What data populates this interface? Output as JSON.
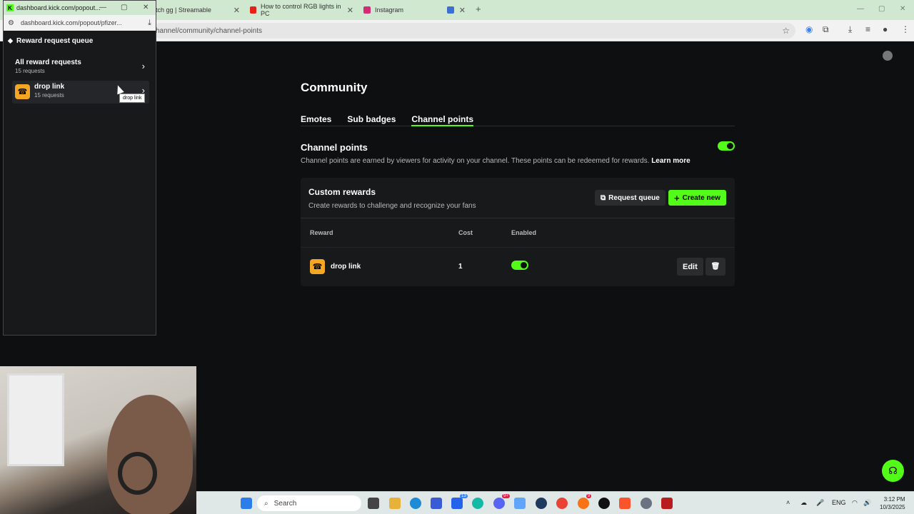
{
  "browser": {
    "tabs": [
      {
        "label": "tch gg | Streamable"
      },
      {
        "label": "How to control RGB lights in PC"
      },
      {
        "label": "Instagram"
      },
      {
        "label": ""
      }
    ],
    "new_tab": "+",
    "url": "hannel/community/channel-points"
  },
  "popout": {
    "title": "dashboard.kick.com/popout...",
    "url": "dashboard.kick.com/popout/pfizer...",
    "heading": "Reward request queue",
    "items": [
      {
        "name": "All reward requests",
        "count": "15 requests"
      },
      {
        "name": "drop link",
        "count": "15 requests"
      }
    ],
    "tooltip": "drop link"
  },
  "community": {
    "title": "Community",
    "tabs": [
      "Emotes",
      "Sub badges",
      "Channel points"
    ],
    "active_tab": "Channel points",
    "channel_points": {
      "title": "Channel points",
      "description": "Channel points are earned by viewers for activity on your channel. These points can be redeemed for rewards.",
      "learn_more": "Learn more",
      "enabled": true
    },
    "custom_rewards": {
      "title": "Custom rewards",
      "subtitle": "Create rewards to challenge and recognize your fans",
      "request_queue": "Request queue",
      "create_new": "Create new",
      "columns": [
        "Reward",
        "Cost",
        "Enabled"
      ],
      "rows": [
        {
          "name": "drop link",
          "cost": "1",
          "enabled": true,
          "edit": "Edit"
        }
      ]
    }
  },
  "taskbar": {
    "search": "Search",
    "badges": [
      "13",
      "9+",
      "9"
    ],
    "lang": "ENG",
    "time": "3:12 PM",
    "date": "10/3/2025"
  },
  "colors": {
    "accent": "#53fc18",
    "reward_icon": "#f5a623",
    "page_bg": "#0e0f10",
    "panel_bg": "#18191b"
  }
}
